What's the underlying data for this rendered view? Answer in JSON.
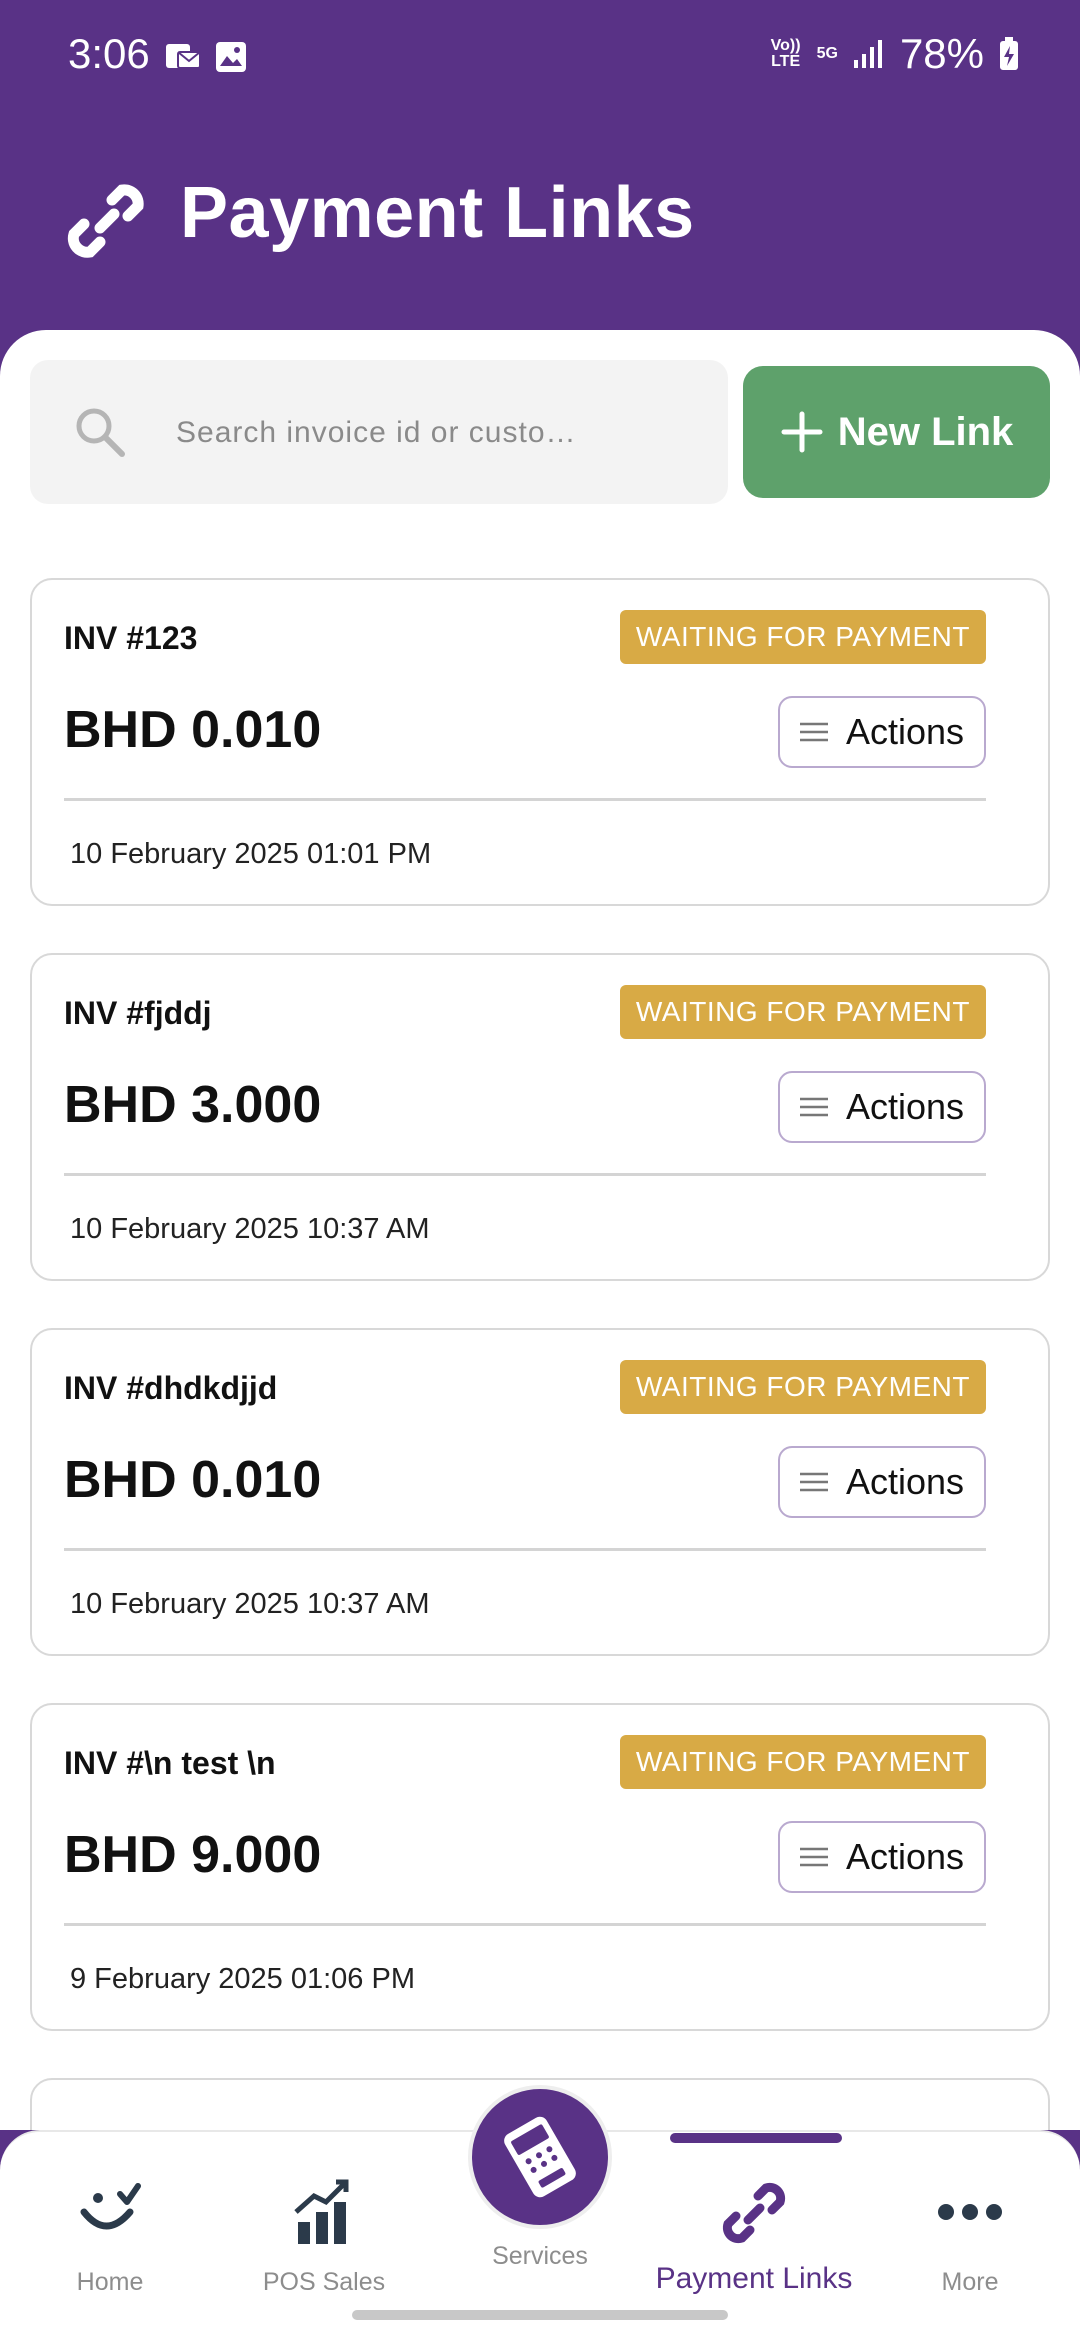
{
  "status_bar": {
    "time": "3:06",
    "battery": "78%",
    "network_5g": "5G",
    "volte": "Vo)) LTE"
  },
  "header": {
    "title": "Payment Links",
    "icon": "link-icon"
  },
  "search": {
    "placeholder": "Search invoice id or custo…"
  },
  "new_link_button": {
    "label": "New Link"
  },
  "cards": [
    {
      "invoice": "INV #123",
      "status": "WAITING FOR PAYMENT",
      "amount": "BHD 0.010",
      "actions": "Actions",
      "date": "10 February 2025 01:01 PM"
    },
    {
      "invoice": "INV #fjddj",
      "status": "WAITING FOR PAYMENT",
      "amount": "BHD 3.000",
      "actions": "Actions",
      "date": "10 February 2025 10:37 AM"
    },
    {
      "invoice": "INV #dhdkdjjd",
      "status": "WAITING FOR PAYMENT",
      "amount": "BHD 0.010",
      "actions": "Actions",
      "date": "10 February 2025 10:37 AM"
    },
    {
      "invoice": "INV #\\n test \\n",
      "status": "WAITING FOR PAYMENT",
      "amount": "BHD 9.000",
      "actions": "Actions",
      "date": "9 February 2025 01:06 PM"
    }
  ],
  "nav": {
    "items": [
      {
        "label": "Home",
        "icon": "smile-icon"
      },
      {
        "label": "POS Sales",
        "icon": "bar-chart-icon"
      },
      {
        "label": "Services",
        "icon": "card-terminal-icon"
      },
      {
        "label": "Payment Links",
        "icon": "link-icon",
        "active": true
      },
      {
        "label": "More",
        "icon": "more-dots-icon"
      }
    ]
  },
  "colors": {
    "brand": "#593286",
    "new_link": "#5ea16b",
    "status_waiting": "#d8aa45"
  }
}
